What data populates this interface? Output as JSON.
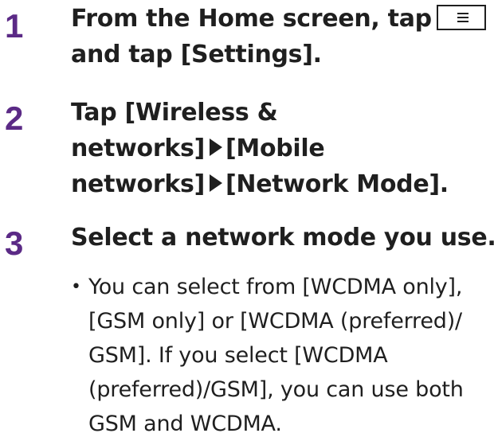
{
  "steps": [
    {
      "number": "1",
      "title_part1": "From the Home screen, tap",
      "title_part2": "and tap [Settings]."
    },
    {
      "number": "2",
      "line1": "Tap [Wireless &",
      "line2_a": "networks]",
      "line2_b": "[Mobile",
      "line3_a": "networks]",
      "line3_b": "[Network Mode]."
    },
    {
      "number": "3",
      "title": "Select a network mode you use.",
      "note_bullet": "•",
      "note": "You can select from [WCDMA only], [GSM only] or [WCDMA (preferred)/ GSM]. If you select [WCDMA (preferred)/GSM], you can use both GSM and WCDMA."
    }
  ],
  "icons": {
    "menu_key": "menu-key-icon",
    "arrow": "right-triangle-arrow-icon"
  },
  "colors": {
    "step_number": "#5b2a86",
    "text": "#1f1f1f"
  }
}
